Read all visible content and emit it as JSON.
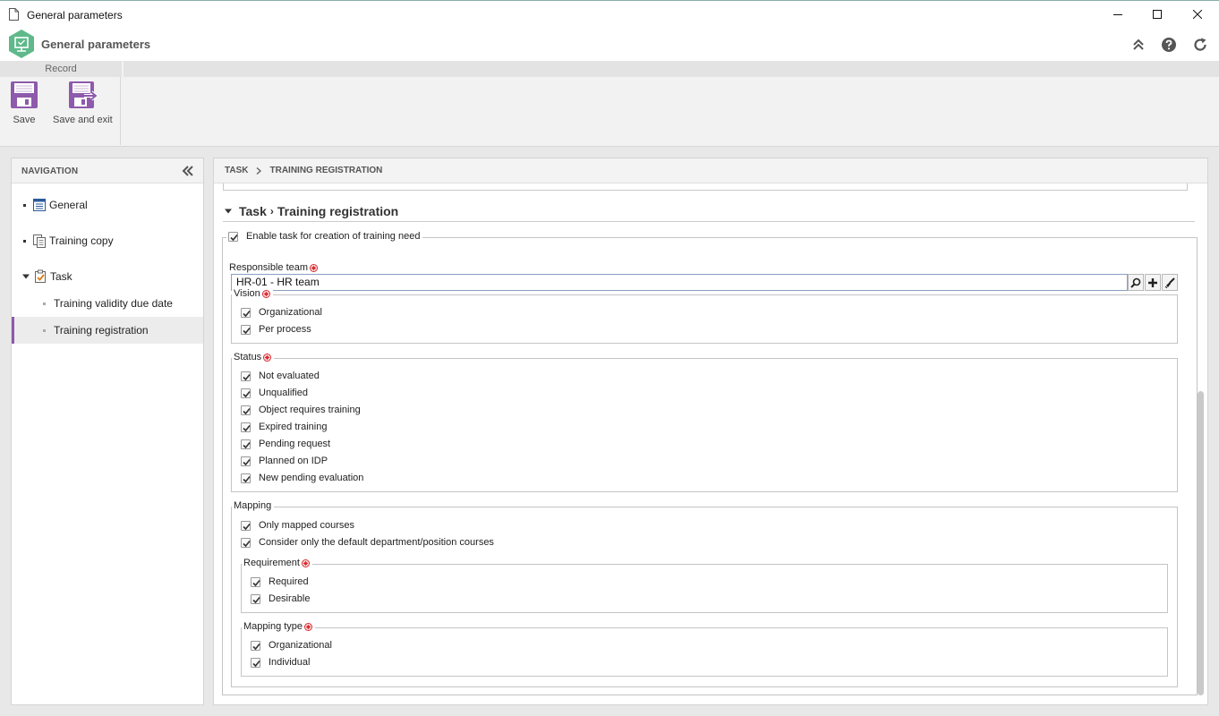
{
  "window": {
    "title": "General parameters"
  },
  "app": {
    "title": "General parameters"
  },
  "ribbon": {
    "group_label": "Record",
    "save_label": "Save",
    "save_exit_label": "Save and exit"
  },
  "nav": {
    "header": "NAVIGATION",
    "items": [
      {
        "label": "General",
        "icon": "list-document-icon"
      },
      {
        "label": "Training copy",
        "icon": "copy-document-icon"
      },
      {
        "label": "Task",
        "icon": "task-checklist-icon"
      },
      {
        "label": "Training validity due date"
      },
      {
        "label": "Training registration"
      }
    ],
    "selected": "Training registration"
  },
  "breadcrumb": {
    "first": "TASK",
    "second": "TRAINING REGISTRATION"
  },
  "section": {
    "part1": "Task",
    "separator": "›",
    "part2": "Training registration"
  },
  "form": {
    "enable_label": "Enable task for creation of training need",
    "responsible_team_label": "Responsible team",
    "responsible_team_value": "HR-01 - HR team",
    "vision": {
      "label": "Vision",
      "options": [
        "Organizational",
        "Per process"
      ]
    },
    "status": {
      "label": "Status",
      "options": [
        "Not evaluated",
        "Unqualified",
        "Object requires training",
        "Expired training",
        "Pending request",
        "Planned on IDP",
        "New pending evaluation"
      ]
    },
    "mapping": {
      "label": "Mapping",
      "options": [
        "Only mapped courses",
        "Consider only the default department/position courses"
      ],
      "requirement": {
        "label": "Requirement",
        "options": [
          "Required",
          "Desirable"
        ]
      },
      "mapping_type": {
        "label": "Mapping type",
        "options": [
          "Organizational",
          "Individual"
        ]
      }
    }
  },
  "colors": {
    "accent": "#8e5aab",
    "logo": "#5fb98a",
    "ribbon_icon": "#8e5aab"
  }
}
